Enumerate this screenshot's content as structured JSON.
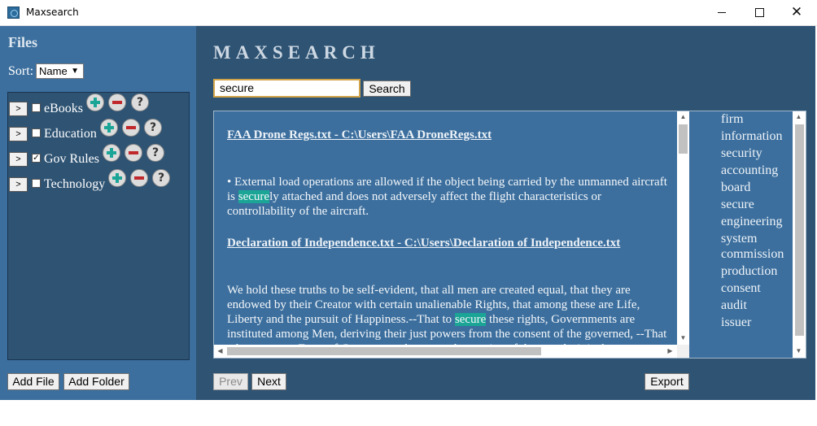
{
  "window": {
    "title": "Maxsearch",
    "controls": {
      "minimize": "minimize",
      "maximize": "maximize",
      "close": "✕"
    }
  },
  "sidebar": {
    "heading": "Files",
    "sort_label": "Sort:",
    "sort_value": "Name",
    "folders": [
      {
        "label": "eBooks",
        "checked": false
      },
      {
        "label": "Education",
        "checked": false
      },
      {
        "label": "Gov Rules",
        "checked": true
      },
      {
        "label": "Technology",
        "checked": false
      }
    ],
    "expand_label": ">",
    "help_label": "?",
    "add_file_label": "Add File",
    "add_folder_label": "Add Folder"
  },
  "main": {
    "brand": "MAXSEARCH",
    "search_value": "secure",
    "search_button": "Search",
    "results": [
      {
        "title": "FAA Drone Regs.txt - C:\\Users\\FAA DroneRegs.txt",
        "before": "• External load operations are allowed if the object being carried by the unmanned aircraft is ",
        "match": "secure",
        "after": "ly attached and does not adversely affect the flight characteristics or controllability of the aircraft."
      },
      {
        "title": "Declaration of Independence.txt - C:\\Users\\Declaration of Independence.txt",
        "before": "We hold these truths to be self-evident, that all men are created equal, that they are endowed by their Creator with certain unalienable Rights, that among these are Life, Liberty and the pursuit of Happiness.--That to ",
        "match": "secure",
        "after": " these rights, Governments are instituted among Men, deriving their just powers from the consent of the governed, --That whenever any Form of Government becomes destructive of these ends, it is the"
      }
    ],
    "keywords": [
      "firm",
      "information",
      "security",
      "accounting",
      "board",
      "secure",
      "engineering",
      "system",
      "commission",
      "production",
      "consent",
      "audit",
      "issuer"
    ],
    "prev_label": "Prev",
    "next_label": "Next",
    "export_label": "Export"
  },
  "colors": {
    "sidebar_bg": "#3c6f9e",
    "main_bg": "#2e5373",
    "highlight": "#1ba596"
  }
}
